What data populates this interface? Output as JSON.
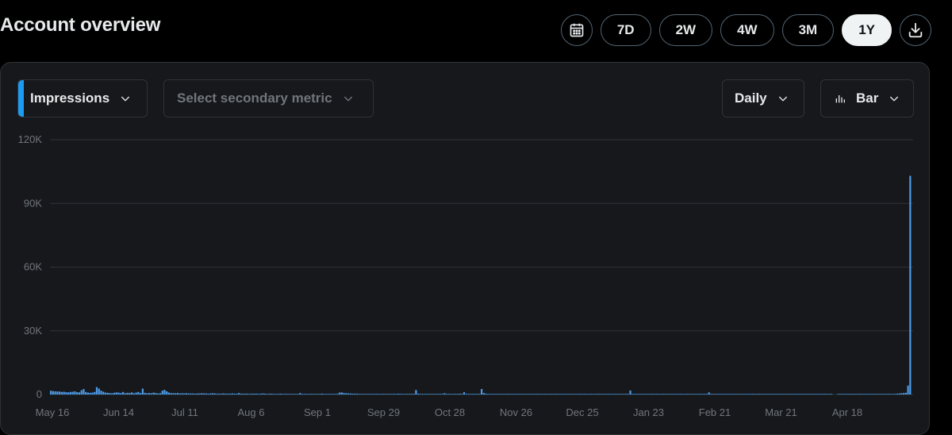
{
  "header": {
    "title": "Account overview",
    "ranges": [
      "7D",
      "2W",
      "4W",
      "3M",
      "1Y"
    ],
    "active_range": "1Y",
    "icons": {
      "calendar": "calendar-icon",
      "download": "download-icon"
    }
  },
  "controls": {
    "primary_metric": "Impressions",
    "secondary_placeholder": "Select secondary metric",
    "interval": "Daily",
    "chart_type": "Bar"
  },
  "colors": {
    "accent": "#1d9bf0",
    "bar": "#4c9be8",
    "active_pill_bg": "#eff3f4"
  },
  "chart_data": {
    "type": "bar",
    "ylim": [
      0,
      120000
    ],
    "y_ticks": [
      {
        "value": 120000,
        "label": "120K"
      },
      {
        "value": 90000,
        "label": "90K"
      },
      {
        "value": 60000,
        "label": "60K"
      },
      {
        "value": 30000,
        "label": "30K"
      },
      {
        "value": 0,
        "label": "0"
      }
    ],
    "x_tick_labels": [
      "May 16",
      "Jun 14",
      "Jul 11",
      "Aug 6",
      "Sep 1",
      "Sep 29",
      "Oct 28",
      "Nov 26",
      "Dec 25",
      "Jan 23",
      "Feb 21",
      "Mar 21",
      "Apr 18"
    ],
    "start_date": "May 16",
    "values": [
      1800,
      1600,
      1500,
      1400,
      1400,
      1200,
      1300,
      1100,
      1000,
      1200,
      1300,
      1500,
      1100,
      1000,
      2000,
      2600,
      1200,
      900,
      800,
      900,
      1200,
      3500,
      2800,
      1800,
      1300,
      900,
      800,
      700,
      600,
      800,
      1000,
      900,
      700,
      1200,
      600,
      800,
      700,
      1000,
      600,
      900,
      1200,
      700,
      2800,
      800,
      600,
      700,
      600,
      900,
      700,
      500,
      600,
      1800,
      2200,
      1500,
      900,
      700,
      600,
      600,
      700,
      500,
      600,
      500,
      600,
      500,
      500,
      500,
      400,
      500,
      500,
      600,
      500,
      500,
      400,
      500,
      600,
      500,
      400,
      400,
      400,
      500,
      400,
      400,
      400,
      500,
      400,
      400,
      700,
      400,
      400,
      400,
      400,
      300,
      400,
      400,
      400,
      300,
      400,
      500,
      400,
      300,
      400,
      400,
      300,
      300,
      300,
      400,
      300,
      300,
      300,
      300,
      300,
      300,
      300,
      300,
      700,
      300,
      300,
      300,
      300,
      300,
      300,
      300,
      300,
      300,
      400,
      300,
      300,
      300,
      300,
      300,
      300,
      300,
      900,
      1000,
      700,
      600,
      500,
      500,
      400,
      400,
      400,
      300,
      300,
      300,
      300,
      300,
      300,
      300,
      300,
      300,
      300,
      300,
      300,
      300,
      300,
      300,
      300,
      300,
      300,
      400,
      300,
      300,
      300,
      300,
      300,
      300,
      300,
      2100,
      400,
      300,
      300,
      300,
      300,
      300,
      300,
      300,
      300,
      300,
      300,
      300,
      600,
      300,
      300,
      300,
      300,
      300,
      300,
      400,
      300,
      1100,
      300,
      300,
      300,
      300,
      300,
      300,
      300,
      2600,
      700,
      400,
      300,
      300,
      300,
      300,
      300,
      300,
      300,
      300,
      300,
      300,
      300,
      300,
      300,
      300,
      300,
      300,
      300,
      300,
      300,
      300,
      300,
      300,
      300,
      300,
      300,
      300,
      300,
      300,
      300,
      300,
      300,
      300,
      300,
      300,
      300,
      300,
      300,
      300,
      300,
      300,
      300,
      300,
      300,
      300,
      300,
      300,
      300,
      300,
      300,
      300,
      300,
      300,
      300,
      300,
      300,
      300,
      300,
      300,
      300,
      300,
      300,
      300,
      300,
      300,
      300,
      1900,
      300,
      300,
      300,
      300,
      300,
      300,
      300,
      300,
      300,
      300,
      300,
      300,
      300,
      300,
      300,
      300,
      300,
      300,
      300,
      300,
      300,
      300,
      300,
      300,
      300,
      300,
      300,
      300,
      300,
      300,
      300,
      300,
      300,
      300,
      300,
      1000,
      300,
      300,
      300,
      300,
      300,
      300,
      300,
      300,
      300,
      300,
      300,
      300,
      300,
      300,
      300,
      300,
      300,
      300,
      300,
      300,
      300,
      300,
      300,
      300,
      300,
      300,
      300,
      300,
      300,
      300,
      300,
      300,
      300,
      300,
      300,
      300,
      300,
      300,
      300,
      300,
      300,
      300,
      300,
      300,
      300,
      300,
      300,
      300,
      300,
      300,
      300,
      300,
      300,
      300,
      300,
      300,
      0,
      0,
      300,
      300,
      300,
      300,
      300,
      300,
      300,
      300,
      300,
      300,
      300,
      300,
      300,
      300,
      300,
      300,
      300,
      300,
      300,
      300,
      300,
      300,
      300,
      300,
      300,
      300,
      300,
      400,
      500,
      600,
      700,
      800,
      4200,
      103000
    ]
  }
}
